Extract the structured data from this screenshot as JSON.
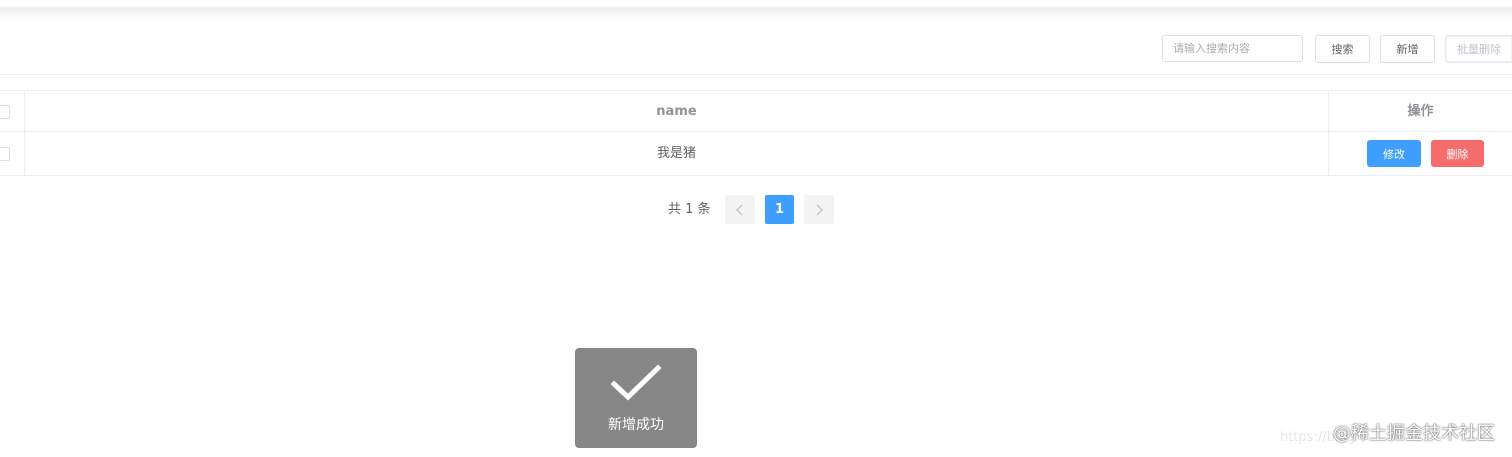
{
  "toolbar": {
    "search_placeholder": "请输入搜索内容",
    "search_label": "搜索",
    "add_label": "新增",
    "batch_delete_label": "批量删除"
  },
  "table": {
    "columns": [
      "name",
      "操作"
    ],
    "rows": [
      {
        "name": "我是猪",
        "edit_label": "修改",
        "delete_label": "删除"
      }
    ]
  },
  "pagination": {
    "total_text": "共 1 条",
    "current_page": "1"
  },
  "toast": {
    "message": "新增成功"
  },
  "watermark": {
    "url": "https://blog",
    "text": "@稀土掘金技术社区"
  },
  "colors": {
    "primary": "#409eff",
    "danger": "#f56c6c",
    "toast_bg": "#878787"
  },
  "icons": {
    "prev": "chevron-left-icon",
    "next": "chevron-right-icon",
    "toast": "checkmark-icon"
  }
}
